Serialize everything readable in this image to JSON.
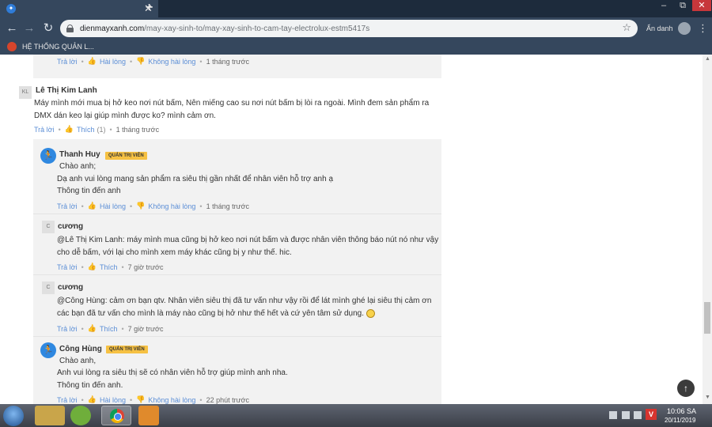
{
  "browser": {
    "new_tab": "+",
    "close_tab": "✕",
    "nav": {
      "back": "←",
      "forward": "→",
      "reload": "↻"
    },
    "url_domain": "dienmayxanh.com",
    "url_path": "/may-xay-sinh-to/may-xay-sinh-to-cam-tay-electrolux-estm5417s",
    "incognito_label": "Ẩn danh",
    "window_controls": {
      "minimize": "‒",
      "maximize": "⧉",
      "close": "✕"
    },
    "bookmark": "HỆ THỐNG QUẢN L..."
  },
  "labels": {
    "reply": "Trả lời",
    "satisfied": "Hài lòng",
    "unsatisfied": "Không hài lòng",
    "like": "Thích",
    "staff_badge": "QUẢN TRỊ VIÊN"
  },
  "comments": {
    "prev_reply_time": "1 tháng trước",
    "main": {
      "initials": "KL",
      "author": "Lê Thị Kim Lanh",
      "line1": "Máy mình mới mua bị hở keo nơi nút bấm, Nên miếng cao su nơi nút bấm bị lòi ra ngoài. Mình đem sản phẩm ra",
      "line2": "DMX dán keo lại giúp mình được ko? mình cảm ơn.",
      "like_count": "(1)",
      "time": "1 tháng trước"
    },
    "replies": [
      {
        "author": "Thanh Huy",
        "lines": [
          "Chào anh;",
          "Dạ anh vui lòng mang sản phẩm ra siêu thị gần nhất để nhân viên hỗ trợ anh ạ",
          "Thông tin đến anh"
        ],
        "time": "1 tháng trước"
      },
      {
        "initials": "C",
        "author": "cương",
        "lines": [
          "@Lê Thị Kim Lanh: máy mình mua cũng bị hở keo nơi nút bấm và được nhân viên thông báo nút nó như vậy",
          "cho dễ bấm, với lại cho mình xem máy khác  cũng bị y như thế.  hic."
        ],
        "time": "7 giờ trước"
      },
      {
        "initials": "C",
        "author": "cương",
        "lines": [
          "@Công Hùng:  cảm ơn bạn qtv. Nhân viên siêu thị đã tư vấn như vậy rồi để lát mình ghé lại siêu thị cảm ơn",
          "các bạn đã tư vấn cho mình là máy nào cũng bị hở như thế hết và cứ yên tâm sử dụng."
        ],
        "time": "7 giờ trước"
      },
      {
        "author": "Công Hùng",
        "lines": [
          "Chào anh,",
          "Anh vui lòng ra siêu thị sẽ có nhân viên hỗ trợ giúp mình anh nha.",
          "Thông tin đến anh."
        ],
        "time": "22 phút trước"
      }
    ]
  },
  "taskbar": {
    "time": "10:06 SA",
    "date": "20/11/2019",
    "tray_letter": "V"
  }
}
